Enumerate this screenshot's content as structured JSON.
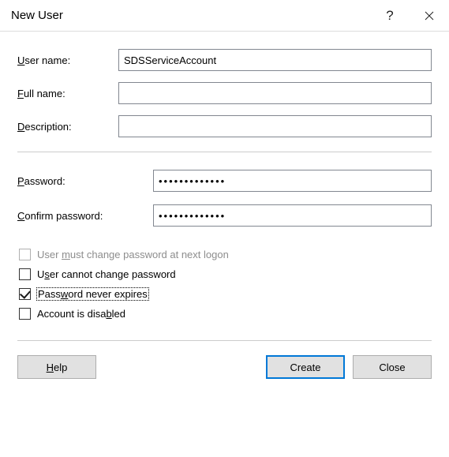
{
  "window": {
    "title": "New User"
  },
  "fields": {
    "username": {
      "label_pre": "",
      "label_ul": "U",
      "label_post": "ser name:",
      "value": "SDSServiceAccount"
    },
    "fullname": {
      "label_pre": "",
      "label_ul": "F",
      "label_post": "ull name:",
      "value": ""
    },
    "description": {
      "label_pre": "",
      "label_ul": "D",
      "label_post": "escription:",
      "value": ""
    },
    "password": {
      "label_pre": "",
      "label_ul": "P",
      "label_post": "assword:",
      "value": "•••••••••••••"
    },
    "confirm": {
      "label_pre": "",
      "label_ul": "C",
      "label_post": "onfirm password:",
      "value": "•••••••••••••"
    }
  },
  "checks": {
    "must_change": {
      "pre": "User ",
      "ul": "m",
      "post": "ust change password at next logon",
      "checked": false,
      "disabled": true
    },
    "cannot_change": {
      "pre": "U",
      "ul": "s",
      "post": "er cannot change password",
      "checked": false,
      "disabled": false
    },
    "never_expires": {
      "pre": "Pass",
      "ul": "w",
      "post": "ord never expires",
      "checked": true,
      "disabled": false,
      "focused": true
    },
    "disabled_acct": {
      "pre": "Account is disa",
      "ul": "b",
      "post": "led",
      "checked": false,
      "disabled": false
    }
  },
  "buttons": {
    "help": {
      "pre": "",
      "ul": "H",
      "post": "elp"
    },
    "create": "Create",
    "close": "Close"
  }
}
